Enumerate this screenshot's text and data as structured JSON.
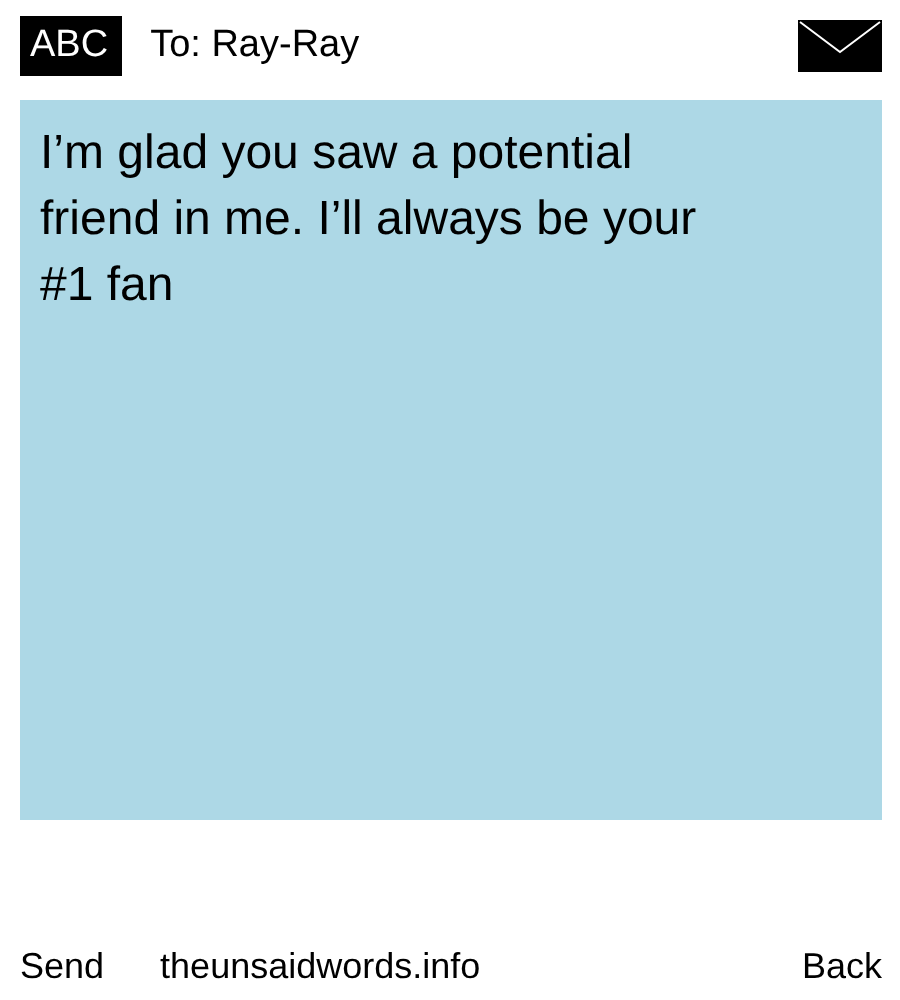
{
  "header": {
    "input_mode": "ABC",
    "recipient": "To: Ray-Ray"
  },
  "message": {
    "text": "I’m glad you saw a potential friend in me. I’ll always be your #1 fan"
  },
  "footer": {
    "send": "Send",
    "site": "theunsaidwords.info",
    "back": "Back"
  }
}
